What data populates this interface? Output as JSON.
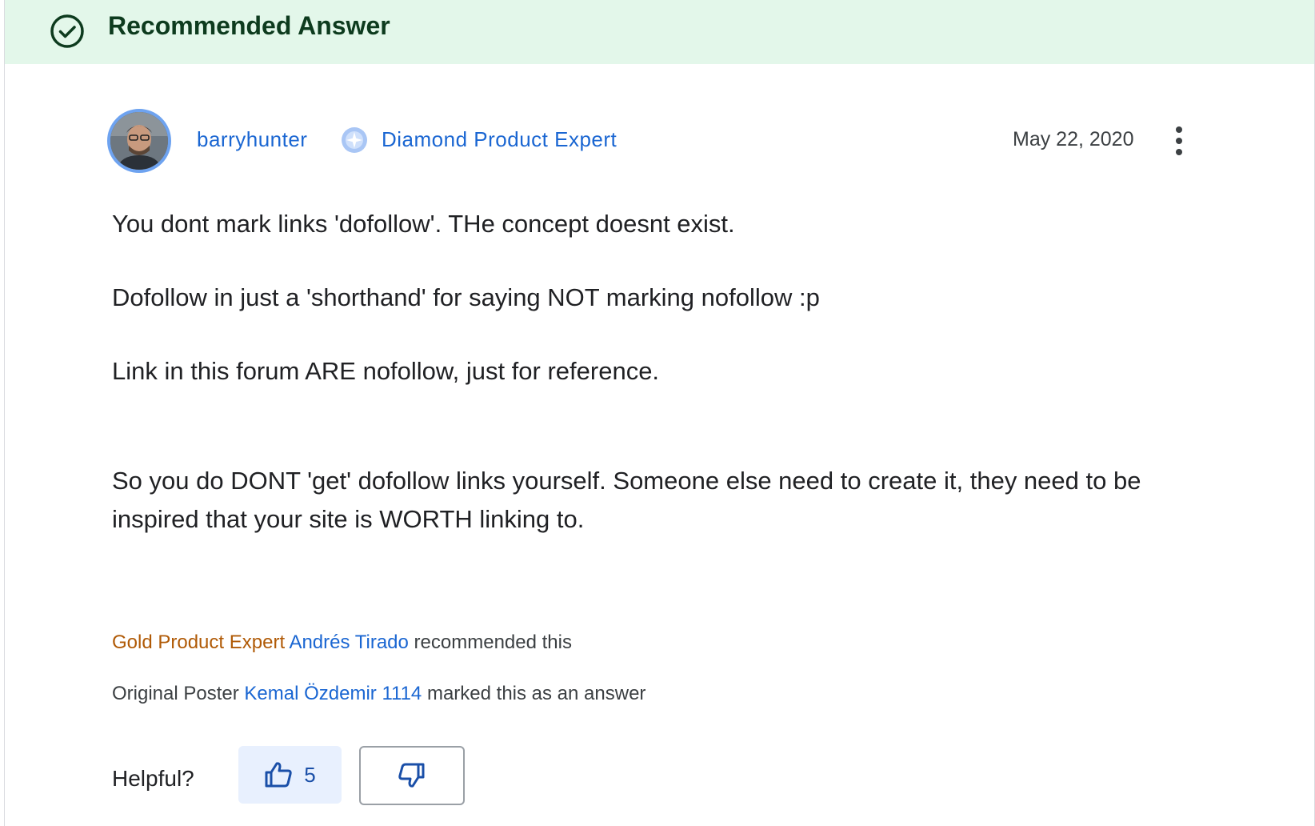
{
  "banner": {
    "title": "Recommended Answer",
    "icon": "check-circle-icon"
  },
  "post": {
    "author": "barryhunter",
    "badge_label": "Diamond Product Expert",
    "badge_icon": "diamond-expert-icon",
    "date": "May 22, 2020",
    "menu_icon": "more-vert-icon",
    "paragraphs": [
      "You dont mark links 'dofollow'. THe concept doesnt exist.",
      "Dofollow in just a 'shorthand' for saying NOT marking nofollow :p",
      "Link in this forum ARE nofollow, just for reference.",
      "So you do DONT 'get' dofollow links yourself. Someone else need to create it, they need to be inspired that your site is WORTH linking to."
    ]
  },
  "recommendation": {
    "level": "Gold Product Expert",
    "name": "Andrés Tirado",
    "suffix": "recommended this"
  },
  "original_poster": {
    "label": "Original Poster",
    "name": "Kemal Özdemir 1114",
    "suffix": "marked this as an answer"
  },
  "feedback": {
    "label": "Helpful?",
    "up_count": "5",
    "up_icon": "thumb-up-icon",
    "down_icon": "thumb-down-icon"
  },
  "colors": {
    "banner_bg": "#e3f7ea",
    "link": "#1a66d2",
    "gold": "#b05a06",
    "upvote_bg": "#e8f0fe"
  }
}
